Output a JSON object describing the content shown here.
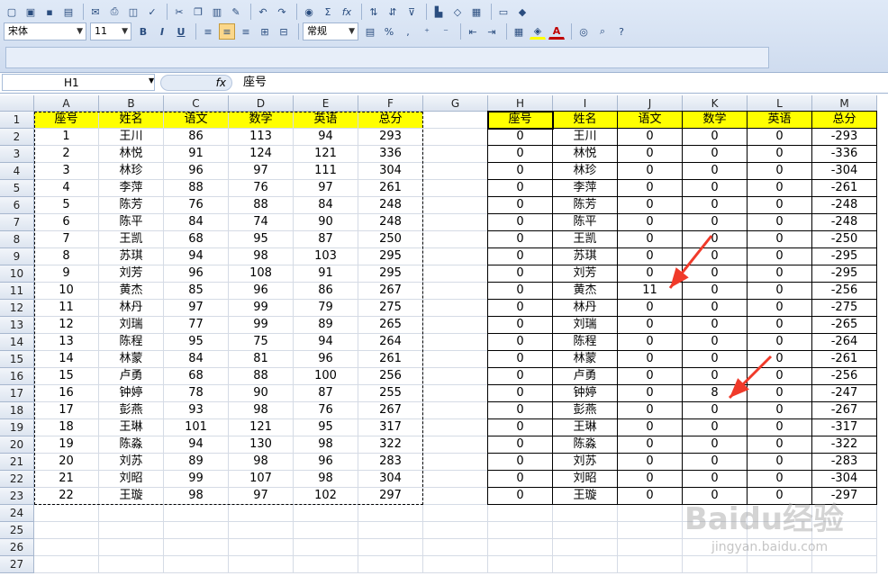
{
  "toolbar": {
    "font_name": "宋体",
    "font_size": "11",
    "bold": "B",
    "italic": "I",
    "underline": "U",
    "number_format": "常规",
    "percent": "%",
    "comma": ",",
    "sigma": "Σ",
    "fx": "fx"
  },
  "formula_bar": {
    "name_box": "H1",
    "fx_label": "fx",
    "content": "座号"
  },
  "columns": [
    "A",
    "B",
    "C",
    "D",
    "E",
    "F",
    "G",
    "H",
    "I",
    "J",
    "K",
    "L",
    "M"
  ],
  "rows": [
    "1",
    "2",
    "3",
    "4",
    "5",
    "6",
    "7",
    "8",
    "9",
    "10",
    "11",
    "12",
    "13",
    "14",
    "15",
    "16",
    "17",
    "18",
    "19",
    "20",
    "21",
    "22",
    "23",
    "24",
    "25",
    "26",
    "27"
  ],
  "table_left": {
    "headers": [
      "座号",
      "姓名",
      "语文",
      "数学",
      "英语",
      "总分"
    ],
    "rows": [
      [
        "1",
        "王川",
        "86",
        "113",
        "94",
        "293"
      ],
      [
        "2",
        "林悦",
        "91",
        "124",
        "121",
        "336"
      ],
      [
        "3",
        "林珍",
        "96",
        "97",
        "111",
        "304"
      ],
      [
        "4",
        "李萍",
        "88",
        "76",
        "97",
        "261"
      ],
      [
        "5",
        "陈芳",
        "76",
        "88",
        "84",
        "248"
      ],
      [
        "6",
        "陈平",
        "84",
        "74",
        "90",
        "248"
      ],
      [
        "7",
        "王凯",
        "68",
        "95",
        "87",
        "250"
      ],
      [
        "8",
        "苏琪",
        "94",
        "98",
        "103",
        "295"
      ],
      [
        "9",
        "刘芳",
        "96",
        "108",
        "91",
        "295"
      ],
      [
        "10",
        "黄杰",
        "85",
        "96",
        "86",
        "267"
      ],
      [
        "11",
        "林丹",
        "97",
        "99",
        "79",
        "275"
      ],
      [
        "12",
        "刘瑞",
        "77",
        "99",
        "89",
        "265"
      ],
      [
        "13",
        "陈程",
        "95",
        "75",
        "94",
        "264"
      ],
      [
        "14",
        "林蒙",
        "84",
        "81",
        "96",
        "261"
      ],
      [
        "15",
        "卢勇",
        "68",
        "88",
        "100",
        "256"
      ],
      [
        "16",
        "钟婷",
        "78",
        "90",
        "87",
        "255"
      ],
      [
        "17",
        "彭燕",
        "93",
        "98",
        "76",
        "267"
      ],
      [
        "18",
        "王琳",
        "101",
        "121",
        "95",
        "317"
      ],
      [
        "19",
        "陈淼",
        "94",
        "130",
        "98",
        "322"
      ],
      [
        "20",
        "刘苏",
        "89",
        "98",
        "96",
        "283"
      ],
      [
        "21",
        "刘昭",
        "99",
        "107",
        "98",
        "304"
      ],
      [
        "22",
        "王璇",
        "98",
        "97",
        "102",
        "297"
      ]
    ]
  },
  "table_right": {
    "headers": [
      "座号",
      "姓名",
      "语文",
      "数学",
      "英语",
      "总分"
    ],
    "rows": [
      [
        "0",
        "王川",
        "0",
        "0",
        "0",
        "-293"
      ],
      [
        "0",
        "林悦",
        "0",
        "0",
        "0",
        "-336"
      ],
      [
        "0",
        "林珍",
        "0",
        "0",
        "0",
        "-304"
      ],
      [
        "0",
        "李萍",
        "0",
        "0",
        "0",
        "-261"
      ],
      [
        "0",
        "陈芳",
        "0",
        "0",
        "0",
        "-248"
      ],
      [
        "0",
        "陈平",
        "0",
        "0",
        "0",
        "-248"
      ],
      [
        "0",
        "王凯",
        "0",
        "0",
        "0",
        "-250"
      ],
      [
        "0",
        "苏琪",
        "0",
        "0",
        "0",
        "-295"
      ],
      [
        "0",
        "刘芳",
        "0",
        "0",
        "0",
        "-295"
      ],
      [
        "0",
        "黄杰",
        "11",
        "0",
        "0",
        "-256"
      ],
      [
        "0",
        "林丹",
        "0",
        "0",
        "0",
        "-275"
      ],
      [
        "0",
        "刘瑞",
        "0",
        "0",
        "0",
        "-265"
      ],
      [
        "0",
        "陈程",
        "0",
        "0",
        "0",
        "-264"
      ],
      [
        "0",
        "林蒙",
        "0",
        "0",
        "0",
        "-261"
      ],
      [
        "0",
        "卢勇",
        "0",
        "0",
        "0",
        "-256"
      ],
      [
        "0",
        "钟婷",
        "0",
        "8",
        "0",
        "-247"
      ],
      [
        "0",
        "彭燕",
        "0",
        "0",
        "0",
        "-267"
      ],
      [
        "0",
        "王琳",
        "0",
        "0",
        "0",
        "-317"
      ],
      [
        "0",
        "陈淼",
        "0",
        "0",
        "0",
        "-322"
      ],
      [
        "0",
        "刘苏",
        "0",
        "0",
        "0",
        "-283"
      ],
      [
        "0",
        "刘昭",
        "0",
        "0",
        "0",
        "-304"
      ],
      [
        "0",
        "王璇",
        "0",
        "0",
        "0",
        "-297"
      ]
    ]
  },
  "colors": {
    "header_fill": "#ffff00",
    "arrow": "#f03a2a"
  },
  "watermark": {
    "brand": "Baidu经验",
    "url": "jingyan.baidu.com"
  }
}
